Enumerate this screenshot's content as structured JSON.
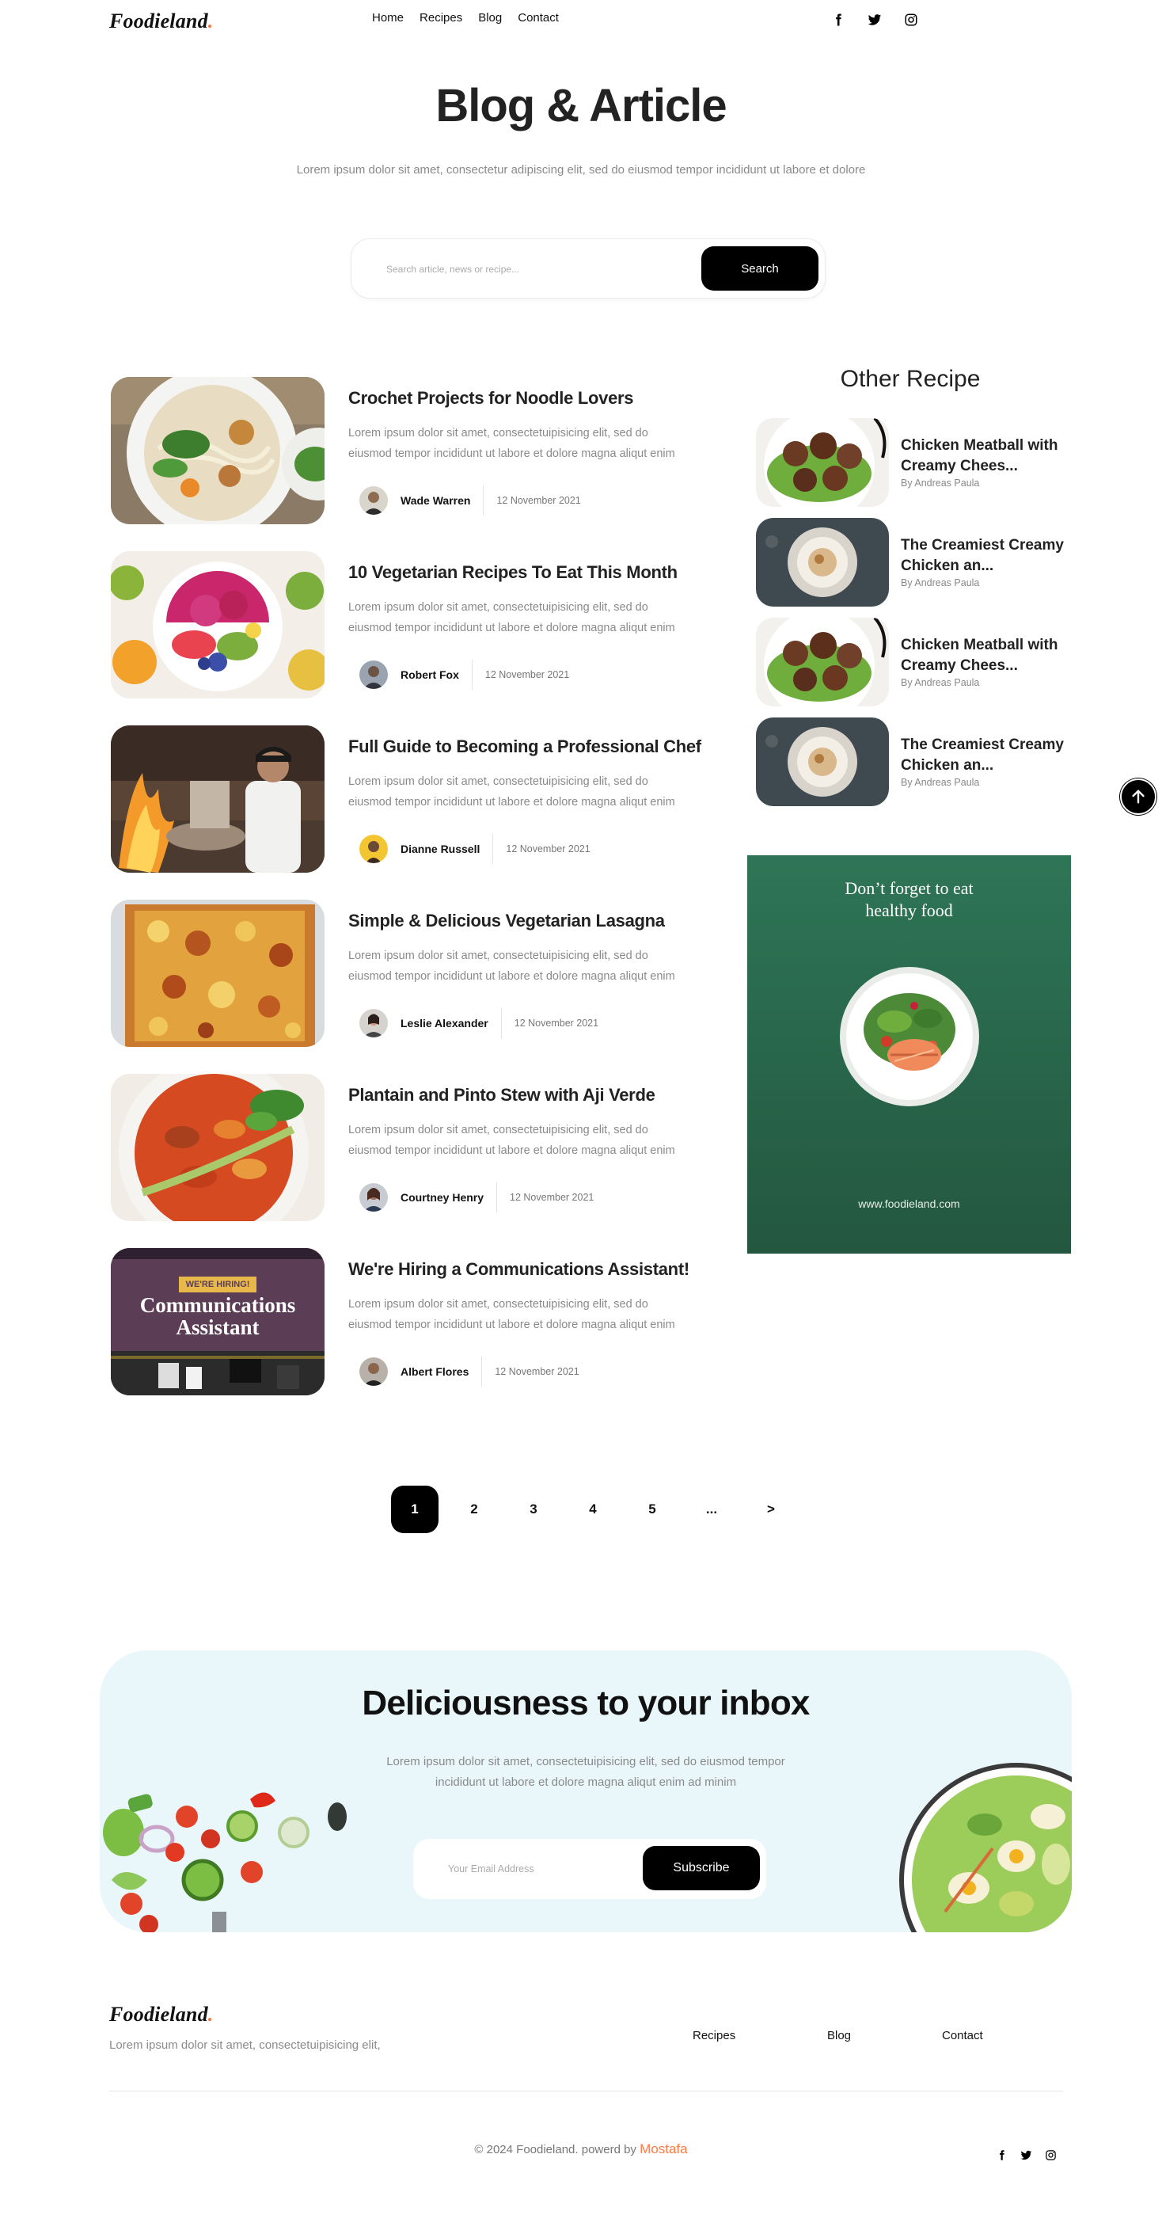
{
  "header": {
    "logo_text": "Foodieland",
    "logo_dot": ".",
    "nav": [
      "Home",
      "Recipes",
      "Blog",
      "Contact"
    ],
    "social_icons": [
      "facebook-icon",
      "twitter-icon",
      "instagram-icon"
    ]
  },
  "hero": {
    "title": "Blog & Article",
    "subtitle": "Lorem ipsum dolor sit amet, consectetur adipiscing elit, sed do eiusmod tempor incididunt ut labore et dolore"
  },
  "search": {
    "placeholder": "Search article, news or recipe...",
    "button": "Search"
  },
  "articles": [
    {
      "title": "Crochet Projects for Noodle Lovers",
      "desc_line1": "Lorem ipsum dolor sit amet, consectetuipisicing elit, sed do",
      "desc_line2": "eiusmod tempor incididunt ut labore et dolore magna aliqut enim",
      "author": "Wade Warren",
      "date": "12 November 2021"
    },
    {
      "title": "10 Vegetarian Recipes To Eat This Month",
      "desc_line1": "Lorem ipsum dolor sit amet, consectetuipisicing elit, sed do",
      "desc_line2": "eiusmod tempor incididunt ut labore et dolore magna aliqut enim",
      "author": "Robert Fox",
      "date": "12 November 2021"
    },
    {
      "title": "Full Guide to Becoming a Professional Chef",
      "desc_line1": "Lorem ipsum dolor sit amet, consectetuipisicing elit, sed do",
      "desc_line2": "eiusmod tempor incididunt ut labore et dolore magna aliqut enim",
      "author": "Dianne Russell",
      "date": "12 November 2021"
    },
    {
      "title": "Simple & Delicious Vegetarian Lasagna",
      "desc_line1": "Lorem ipsum dolor sit amet, consectetuipisicing elit, sed do",
      "desc_line2": "eiusmod tempor incididunt ut labore et dolore magna aliqut enim",
      "author": "Leslie Alexander",
      "date": "12 November 2021"
    },
    {
      "title": "Plantain and Pinto Stew with Aji Verde",
      "desc_line1": "Lorem ipsum dolor sit amet, consectetuipisicing elit, sed do",
      "desc_line2": "eiusmod tempor incididunt ut labore et dolore magna aliqut enim",
      "author": "Courtney Henry",
      "date": "12 November 2021"
    },
    {
      "title": "We're Hiring a Communications Assistant!",
      "desc_line1": "Lorem ipsum dolor sit amet, consectetuipisicing elit, sed do",
      "desc_line2": "eiusmod tempor incididunt ut labore et dolore magna aliqut enim",
      "author": "Albert Flores",
      "date": "12 November 2021",
      "image_badge": "WE'RE HIRING!",
      "image_line1": "Communications",
      "image_line2": "Assistant"
    }
  ],
  "sidebar": {
    "title": "Other Recipe",
    "recipes": [
      {
        "line1": "Chicken Meatball with",
        "line2": "Creamy Chees...",
        "by": "By Andreas Paula"
      },
      {
        "line1": "The Creamiest Creamy",
        "line2": "Chicken an...",
        "by": "By Andreas Paula"
      },
      {
        "line1": "Chicken Meatball with",
        "line2": "Creamy Chees...",
        "by": "By Andreas Paula"
      },
      {
        "line1": "The Creamiest Creamy",
        "line2": "Chicken an...",
        "by": "By Andreas Paula"
      }
    ],
    "promo": {
      "line1": "Don’t forget to eat",
      "line2": "healthy food",
      "url": "www.foodieland.com"
    }
  },
  "pagination": {
    "pages": [
      "1",
      "2",
      "3",
      "4",
      "5",
      "...",
      ">"
    ],
    "active": "1"
  },
  "newsletter": {
    "title": "Deliciousness to your inbox",
    "desc_line1": "Lorem ipsum dolor sit amet, consectetuipisicing elit, sed do eiusmod tempor",
    "desc_line2": "incididunt ut labore et dolore magna aliqut enim ad minim",
    "placeholder": "Your Email Address",
    "button": "Subscribe"
  },
  "footer": {
    "logo_text": "Foodieland",
    "logo_dot": ".",
    "tagline": "Lorem ipsum dolor sit amet, consectetuipisicing elit,",
    "links": [
      "Recipes",
      "Blog",
      "Contact"
    ],
    "copyright": "© 2024 Foodieland. powerd by",
    "author": "Mostafa",
    "social_icons": [
      "facebook-icon",
      "twitter-icon",
      "instagram-icon"
    ]
  },
  "colors": {
    "accent": "#ff7a45",
    "primary_button": "#000000",
    "newsletter_bg": "#e9f7fb",
    "promo_bg": "#2e7556"
  }
}
